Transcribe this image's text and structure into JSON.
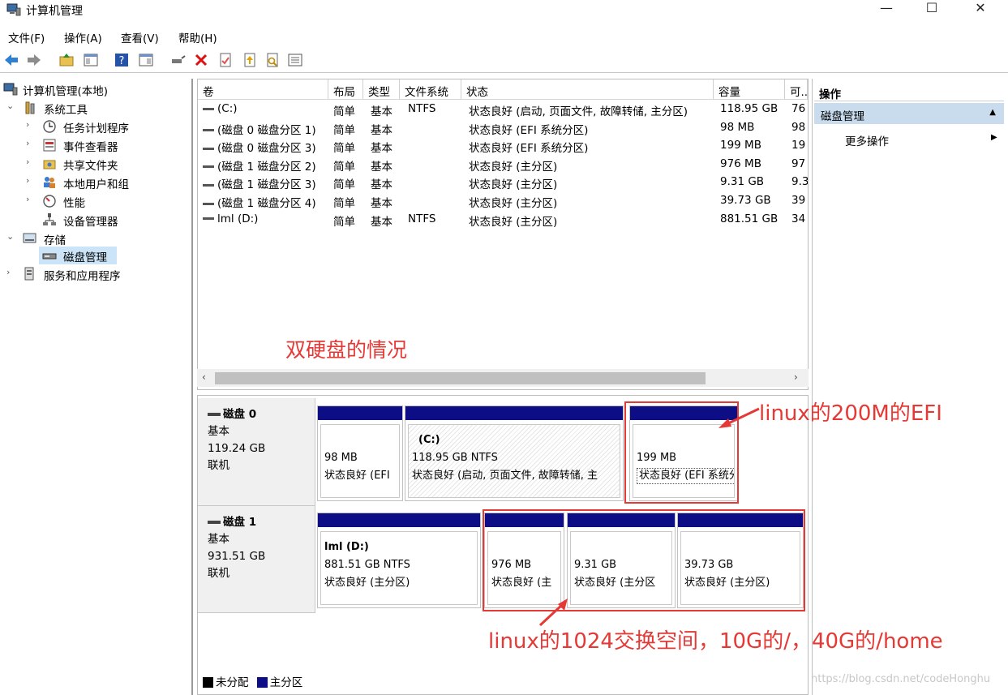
{
  "window": {
    "title": "计算机管理",
    "min": "—",
    "max": "☐",
    "close": "✕"
  },
  "menu": [
    "文件(F)",
    "操作(A)",
    "查看(V)",
    "帮助(H)"
  ],
  "tree": {
    "root": "计算机管理(本地)",
    "system_tools": "系统工具",
    "task_scheduler": "任务计划程序",
    "event_viewer": "事件查看器",
    "shared_folders": "共享文件夹",
    "local_users": "本地用户和组",
    "performance": "性能",
    "device_manager": "设备管理器",
    "storage": "存储",
    "disk_management": "磁盘管理",
    "services_apps": "服务和应用程序"
  },
  "columns": [
    "卷",
    "布局",
    "类型",
    "文件系统",
    "状态",
    "容量",
    "可..."
  ],
  "volumes": [
    {
      "vol": "(C:)",
      "layout": "简单",
      "type": "基本",
      "fs": "NTFS",
      "status": "状态良好 (启动, 页面文件, 故障转储, 主分区)",
      "cap": "118.95 GB",
      "free": "76"
    },
    {
      "vol": "(磁盘 0 磁盘分区 1)",
      "layout": "简单",
      "type": "基本",
      "fs": "",
      "status": "状态良好 (EFI 系统分区)",
      "cap": "98 MB",
      "free": "98"
    },
    {
      "vol": "(磁盘 0 磁盘分区 3)",
      "layout": "简单",
      "type": "基本",
      "fs": "",
      "status": "状态良好 (EFI 系统分区)",
      "cap": "199 MB",
      "free": "19"
    },
    {
      "vol": "(磁盘 1 磁盘分区 2)",
      "layout": "简单",
      "type": "基本",
      "fs": "",
      "status": "状态良好 (主分区)",
      "cap": "976 MB",
      "free": "97"
    },
    {
      "vol": "(磁盘 1 磁盘分区 3)",
      "layout": "简单",
      "type": "基本",
      "fs": "",
      "status": "状态良好 (主分区)",
      "cap": "9.31 GB",
      "free": "9.3"
    },
    {
      "vol": "(磁盘 1 磁盘分区 4)",
      "layout": "简单",
      "type": "基本",
      "fs": "",
      "status": "状态良好 (主分区)",
      "cap": "39.73 GB",
      "free": "39"
    },
    {
      "vol": "lml (D:)",
      "layout": "简单",
      "type": "基本",
      "fs": "NTFS",
      "status": "状态良好 (主分区)",
      "cap": "881.51 GB",
      "free": "34"
    }
  ],
  "disks": [
    {
      "name": "磁盘 0",
      "kind": "基本",
      "size": "119.24 GB",
      "state": "联机",
      "parts": [
        {
          "name": "",
          "size": "98 MB",
          "status": "状态良好 (EFI"
        },
        {
          "name": "(C:)",
          "size": "118.95 GB NTFS",
          "status": "状态良好 (启动, 页面文件, 故障转储, 主"
        },
        {
          "name": "",
          "size": "199 MB",
          "status": "状态良好 (EFI 系统分区)"
        }
      ]
    },
    {
      "name": "磁盘 1",
      "kind": "基本",
      "size": "931.51 GB",
      "state": "联机",
      "parts": [
        {
          "name": "lml  (D:)",
          "size": "881.51 GB NTFS",
          "status": "状态良好 (主分区)"
        },
        {
          "name": "",
          "size": "976 MB",
          "status": "状态良好 (主"
        },
        {
          "name": "",
          "size": "9.31 GB",
          "status": "状态良好 (主分区"
        },
        {
          "name": "",
          "size": "39.73 GB",
          "status": "状态良好 (主分区)"
        }
      ]
    }
  ],
  "legend": {
    "unallocated": "未分配",
    "primary": "主分区"
  },
  "actions": {
    "header": "操作",
    "group": "磁盘管理",
    "more": "更多操作"
  },
  "annotations": {
    "dual_disk": "双硬盘的情况",
    "efi": "linux的200M的EFI",
    "swap": "linux的1024交换空间，10G的/，40G的/home"
  },
  "watermark": "https://blog.csdn.net/codeHonghu",
  "colors": {
    "partition_bar": "#0d0d85",
    "annotation": "#e53935",
    "selection": "#cce4f7"
  }
}
